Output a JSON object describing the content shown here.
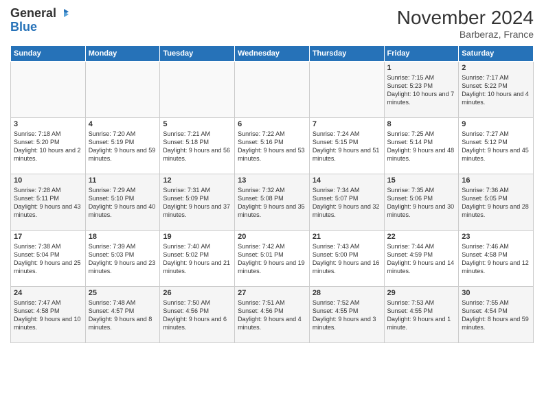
{
  "header": {
    "logo_line1": "General",
    "logo_line2": "Blue",
    "month_title": "November 2024",
    "location": "Barberaz, France"
  },
  "weekdays": [
    "Sunday",
    "Monday",
    "Tuesday",
    "Wednesday",
    "Thursday",
    "Friday",
    "Saturday"
  ],
  "weeks": [
    [
      {
        "day": "",
        "content": ""
      },
      {
        "day": "",
        "content": ""
      },
      {
        "day": "",
        "content": ""
      },
      {
        "day": "",
        "content": ""
      },
      {
        "day": "",
        "content": ""
      },
      {
        "day": "1",
        "content": "Sunrise: 7:15 AM\nSunset: 5:23 PM\nDaylight: 10 hours\nand 7 minutes."
      },
      {
        "day": "2",
        "content": "Sunrise: 7:17 AM\nSunset: 5:22 PM\nDaylight: 10 hours\nand 4 minutes."
      }
    ],
    [
      {
        "day": "3",
        "content": "Sunrise: 7:18 AM\nSunset: 5:20 PM\nDaylight: 10 hours\nand 2 minutes."
      },
      {
        "day": "4",
        "content": "Sunrise: 7:20 AM\nSunset: 5:19 PM\nDaylight: 9 hours\nand 59 minutes."
      },
      {
        "day": "5",
        "content": "Sunrise: 7:21 AM\nSunset: 5:18 PM\nDaylight: 9 hours\nand 56 minutes."
      },
      {
        "day": "6",
        "content": "Sunrise: 7:22 AM\nSunset: 5:16 PM\nDaylight: 9 hours\nand 53 minutes."
      },
      {
        "day": "7",
        "content": "Sunrise: 7:24 AM\nSunset: 5:15 PM\nDaylight: 9 hours\nand 51 minutes."
      },
      {
        "day": "8",
        "content": "Sunrise: 7:25 AM\nSunset: 5:14 PM\nDaylight: 9 hours\nand 48 minutes."
      },
      {
        "day": "9",
        "content": "Sunrise: 7:27 AM\nSunset: 5:12 PM\nDaylight: 9 hours\nand 45 minutes."
      }
    ],
    [
      {
        "day": "10",
        "content": "Sunrise: 7:28 AM\nSunset: 5:11 PM\nDaylight: 9 hours\nand 43 minutes."
      },
      {
        "day": "11",
        "content": "Sunrise: 7:29 AM\nSunset: 5:10 PM\nDaylight: 9 hours\nand 40 minutes."
      },
      {
        "day": "12",
        "content": "Sunrise: 7:31 AM\nSunset: 5:09 PM\nDaylight: 9 hours\nand 37 minutes."
      },
      {
        "day": "13",
        "content": "Sunrise: 7:32 AM\nSunset: 5:08 PM\nDaylight: 9 hours\nand 35 minutes."
      },
      {
        "day": "14",
        "content": "Sunrise: 7:34 AM\nSunset: 5:07 PM\nDaylight: 9 hours\nand 32 minutes."
      },
      {
        "day": "15",
        "content": "Sunrise: 7:35 AM\nSunset: 5:06 PM\nDaylight: 9 hours\nand 30 minutes."
      },
      {
        "day": "16",
        "content": "Sunrise: 7:36 AM\nSunset: 5:05 PM\nDaylight: 9 hours\nand 28 minutes."
      }
    ],
    [
      {
        "day": "17",
        "content": "Sunrise: 7:38 AM\nSunset: 5:04 PM\nDaylight: 9 hours\nand 25 minutes."
      },
      {
        "day": "18",
        "content": "Sunrise: 7:39 AM\nSunset: 5:03 PM\nDaylight: 9 hours\nand 23 minutes."
      },
      {
        "day": "19",
        "content": "Sunrise: 7:40 AM\nSunset: 5:02 PM\nDaylight: 9 hours\nand 21 minutes."
      },
      {
        "day": "20",
        "content": "Sunrise: 7:42 AM\nSunset: 5:01 PM\nDaylight: 9 hours\nand 19 minutes."
      },
      {
        "day": "21",
        "content": "Sunrise: 7:43 AM\nSunset: 5:00 PM\nDaylight: 9 hours\nand 16 minutes."
      },
      {
        "day": "22",
        "content": "Sunrise: 7:44 AM\nSunset: 4:59 PM\nDaylight: 9 hours\nand 14 minutes."
      },
      {
        "day": "23",
        "content": "Sunrise: 7:46 AM\nSunset: 4:58 PM\nDaylight: 9 hours\nand 12 minutes."
      }
    ],
    [
      {
        "day": "24",
        "content": "Sunrise: 7:47 AM\nSunset: 4:58 PM\nDaylight: 9 hours\nand 10 minutes."
      },
      {
        "day": "25",
        "content": "Sunrise: 7:48 AM\nSunset: 4:57 PM\nDaylight: 9 hours\nand 8 minutes."
      },
      {
        "day": "26",
        "content": "Sunrise: 7:50 AM\nSunset: 4:56 PM\nDaylight: 9 hours\nand 6 minutes."
      },
      {
        "day": "27",
        "content": "Sunrise: 7:51 AM\nSunset: 4:56 PM\nDaylight: 9 hours\nand 4 minutes."
      },
      {
        "day": "28",
        "content": "Sunrise: 7:52 AM\nSunset: 4:55 PM\nDaylight: 9 hours\nand 3 minutes."
      },
      {
        "day": "29",
        "content": "Sunrise: 7:53 AM\nSunset: 4:55 PM\nDaylight: 9 hours\nand 1 minute."
      },
      {
        "day": "30",
        "content": "Sunrise: 7:55 AM\nSunset: 4:54 PM\nDaylight: 8 hours\nand 59 minutes."
      }
    ]
  ]
}
